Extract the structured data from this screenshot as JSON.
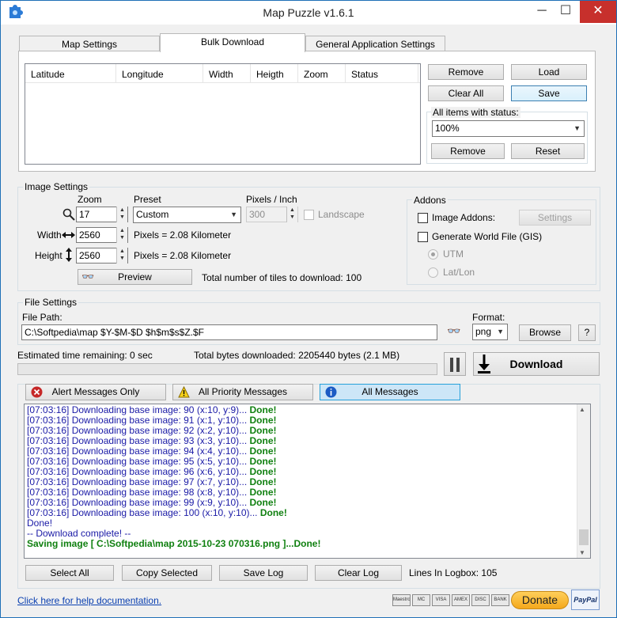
{
  "window": {
    "title": "Map Puzzle v1.6.1",
    "min_label": "─",
    "max_label": "☐",
    "close_label": "✕"
  },
  "tabs": [
    {
      "label": "Map Settings"
    },
    {
      "label": "Bulk Download"
    },
    {
      "label": "General Application Settings"
    }
  ],
  "bulk": {
    "columns": [
      "Latitude",
      "Longitude",
      "Width",
      "Heigth",
      "Zoom",
      "Status"
    ],
    "buttons": {
      "remove": "Remove",
      "load": "Load",
      "clear_all": "Clear All",
      "save": "Save"
    },
    "status_group": "All items with status:",
    "status_value": "100%",
    "status_remove": "Remove",
    "status_reset": "Reset"
  },
  "image_settings": {
    "title": "Image Settings",
    "zoom_label": "Zoom",
    "zoom_value": "17",
    "preset_label": "Preset",
    "preset_value": "Custom",
    "ppi_label": "Pixels / Inch",
    "ppi_value": "300",
    "landscape_label": "Landscape",
    "width_label": "Width",
    "width_value": "2560",
    "width_info": "Pixels = 2.08 Kilometer",
    "height_label": "Height",
    "height_value": "2560",
    "height_info": "Pixels = 2.08 Kilometer",
    "preview_label": "Preview",
    "tiles_text": "Total number of tiles to download: 100"
  },
  "addons": {
    "title": "Addons",
    "image_addons": "Image Addons:",
    "settings_label": "Settings",
    "world_file": "Generate World File (GIS)",
    "utm": "UTM",
    "latlon": "Lat/Lon"
  },
  "file_settings": {
    "title": "File Settings",
    "path_label": "File Path:",
    "path_value": "C:\\Softpedia\\map $Y-$M-$D $h$m$s$Z.$F",
    "format_label": "Format:",
    "format_value": "png",
    "browse": "Browse",
    "help": "?"
  },
  "download": {
    "eta": "Estimated time remaining: 0 sec",
    "bytes": "Total bytes downloaded: 2205440 bytes (2.1 MB)",
    "progress": 0,
    "button": "Download"
  },
  "filters": {
    "alert": "Alert Messages Only",
    "priority": "All Priority Messages",
    "all": "All Messages"
  },
  "log": {
    "lines": [
      {
        "text": "[07:03:16] Downloading base image: 90 (x:10, y:9)... ",
        "done": "Done!"
      },
      {
        "text": "[07:03:16] Downloading base image: 91 (x:1, y:10)... ",
        "done": "Done!"
      },
      {
        "text": "[07:03:16] Downloading base image: 92 (x:2, y:10)... ",
        "done": "Done!"
      },
      {
        "text": "[07:03:16] Downloading base image: 93 (x:3, y:10)... ",
        "done": "Done!"
      },
      {
        "text": "[07:03:16] Downloading base image: 94 (x:4, y:10)... ",
        "done": "Done!"
      },
      {
        "text": "[07:03:16] Downloading base image: 95 (x:5, y:10)... ",
        "done": "Done!"
      },
      {
        "text": "[07:03:16] Downloading base image: 96 (x:6, y:10)... ",
        "done": "Done!"
      },
      {
        "text": "[07:03:16] Downloading base image: 97 (x:7, y:10)... ",
        "done": "Done!"
      },
      {
        "text": "[07:03:16] Downloading base image: 98 (x:8, y:10)... ",
        "done": "Done!"
      },
      {
        "text": "[07:03:16] Downloading base image: 99 (x:9, y:10)... ",
        "done": "Done!"
      },
      {
        "text": "[07:03:16] Downloading base image: 100 (x:10, y:10)... ",
        "done": "Done!"
      }
    ],
    "done_line": "Done!",
    "complete_line": "-- Download complete! --",
    "saving_line": "Saving image [ C:\\Softpedia\\map 2015-10-23 070316.png ]...Done!"
  },
  "log_buttons": {
    "select_all": "Select All",
    "copy_selected": "Copy Selected",
    "save_log": "Save Log",
    "clear_log": "Clear Log",
    "lines_in_logbox": "Lines In Logbox: 105"
  },
  "footer": {
    "help_link": "Click here for help documentation.",
    "cards": [
      "Maestro",
      "MC",
      "VISA",
      "AMEX",
      "DISC",
      "BANK"
    ],
    "donate": "Donate",
    "paypal": "PayPal"
  },
  "colors": {
    "accent": "#1e6fb6",
    "close": "#c7302c",
    "log_text": "#1a1aa6",
    "log_done": "#108010"
  }
}
